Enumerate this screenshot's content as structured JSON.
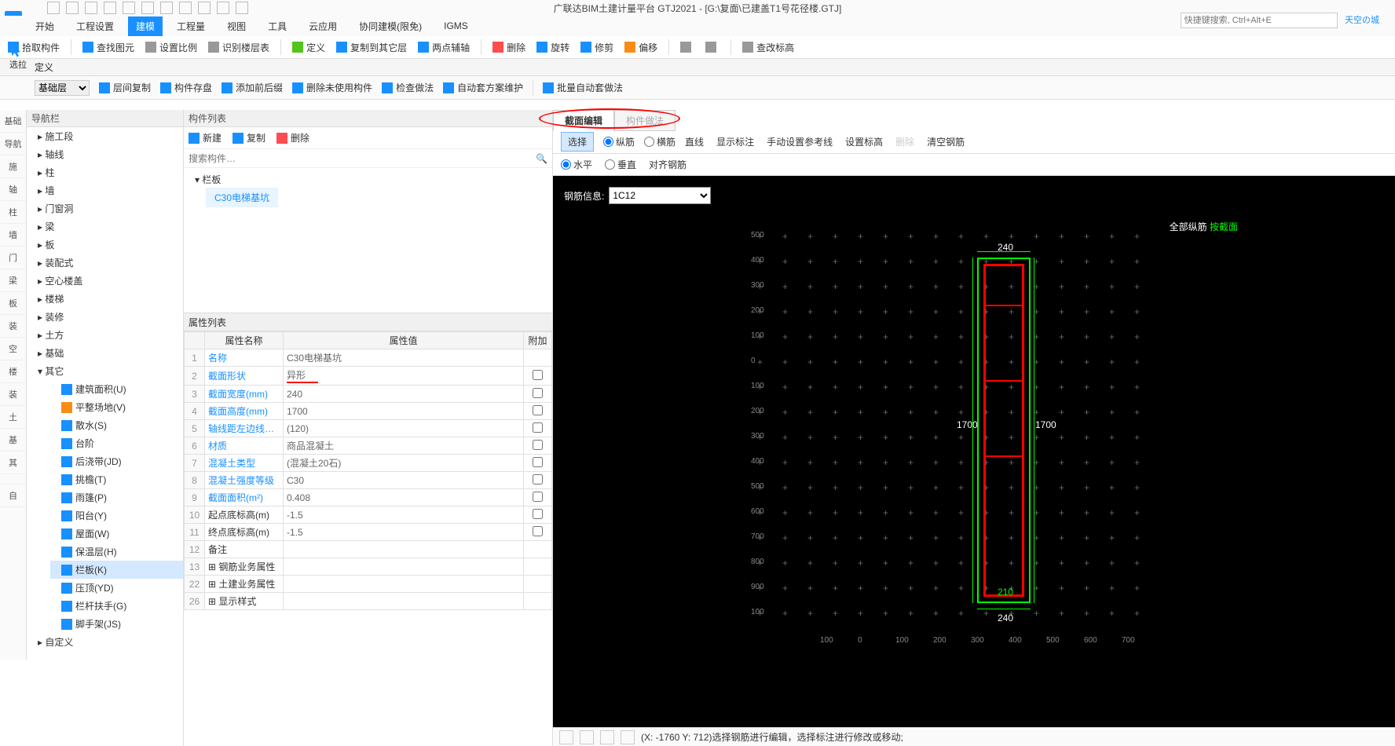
{
  "title": "广联达BIM土建计量平台 GTJ2021 - [G:\\复面\\已建盖T1号花径楼.GTJ]",
  "search_placeholder": "快捷键搜索, Ctrl+Alt+E",
  "user_label": "天空の城",
  "main_tabs": [
    "开始",
    "工程设置",
    "建模",
    "工程量",
    "视图",
    "工具",
    "云应用",
    "协同建模(限免)",
    "IGMS"
  ],
  "main_tab_active_idx": 2,
  "ribbon_row1": [
    {
      "label": "拾取构件",
      "ic": "blue"
    },
    {
      "label": "查找图元",
      "ic": "blue"
    },
    {
      "label": "设置比例",
      "ic": "gray"
    },
    {
      "label": "识别楼层表",
      "ic": "gray"
    },
    {
      "label": "定义",
      "ic": "green"
    },
    {
      "label": "复制到其它层",
      "ic": "blue"
    },
    {
      "label": "两点辅轴",
      "ic": "blue"
    },
    {
      "label": "删除",
      "ic": "red"
    },
    {
      "label": "旋转",
      "ic": "blue"
    },
    {
      "label": "修剪",
      "ic": "blue"
    },
    {
      "label": "偏移",
      "ic": "orange"
    },
    {
      "label": "",
      "ic": "gray"
    },
    {
      "label": "",
      "ic": "gray"
    },
    {
      "label": "查改标高",
      "ic": "gray"
    }
  ],
  "cursor_label": "选拉",
  "def_title": "定义",
  "sub_ribbon": {
    "combo_value": "基础层",
    "items": [
      "层间复制",
      "构件存盘",
      "添加前后缀",
      "删除未使用构件",
      "检查做法",
      "自动套方案维护",
      "批量自动套做法"
    ]
  },
  "left_strip": [
    "基础",
    "导航",
    "施",
    "轴",
    "柱",
    "墙",
    "门",
    "梁",
    "板",
    "装",
    "空",
    "楼",
    "装",
    "土",
    "基",
    "其",
    "",
    "自"
  ],
  "nav_header": "导航栏",
  "nav_tree": [
    {
      "label": "施工段",
      "exp": true
    },
    {
      "label": "轴线",
      "exp": true
    },
    {
      "label": "柱",
      "exp": true
    },
    {
      "label": "墙",
      "exp": true
    },
    {
      "label": "门窗洞",
      "exp": true
    },
    {
      "label": "梁",
      "exp": true
    },
    {
      "label": "板",
      "exp": true
    },
    {
      "label": "装配式",
      "exp": true
    },
    {
      "label": "空心楼盖",
      "exp": true
    },
    {
      "label": "楼梯",
      "exp": true
    },
    {
      "label": "装修",
      "exp": true
    },
    {
      "label": "土方",
      "exp": true
    },
    {
      "label": "基础",
      "exp": true
    },
    {
      "label": "其它",
      "exp": false,
      "children": [
        {
          "label": "建筑面积(U)",
          "ic": "blue"
        },
        {
          "label": "平整场地(V)",
          "ic": "orange"
        },
        {
          "label": "散水(S)",
          "ic": "blue"
        },
        {
          "label": "台阶",
          "ic": "blue"
        },
        {
          "label": "后浇带(JD)",
          "ic": "blue"
        },
        {
          "label": "挑檐(T)",
          "ic": "blue"
        },
        {
          "label": "雨篷(P)",
          "ic": "blue"
        },
        {
          "label": "阳台(Y)",
          "ic": "blue"
        },
        {
          "label": "屋面(W)",
          "ic": "blue"
        },
        {
          "label": "保温层(H)",
          "ic": "blue"
        },
        {
          "label": "栏板(K)",
          "ic": "blue",
          "sel": true
        },
        {
          "label": "压顶(YD)",
          "ic": "blue"
        },
        {
          "label": "栏杆扶手(G)",
          "ic": "blue"
        },
        {
          "label": "脚手架(JS)",
          "ic": "blue"
        }
      ]
    },
    {
      "label": "自定义",
      "exp": true
    }
  ],
  "comp_header": "构件列表",
  "comp_toolbar": [
    "新建",
    "复制",
    "删除"
  ],
  "comp_search_placeholder": "搜索构件…",
  "comp_tree_root": "栏板",
  "comp_tree_child": "C30电梯基坑",
  "prop_header": "属性列表",
  "prop_cols": [
    "属性名称",
    "属性值",
    "附加"
  ],
  "prop_rows": [
    {
      "n": "1",
      "name": "名称",
      "val": "C30电梯基坑",
      "blue": true
    },
    {
      "n": "2",
      "name": "截面形状",
      "val": "异形",
      "blue": true,
      "underline": true
    },
    {
      "n": "3",
      "name": "截面宽度(mm)",
      "val": "240",
      "blue": true
    },
    {
      "n": "4",
      "name": "截面高度(mm)",
      "val": "1700",
      "blue": true
    },
    {
      "n": "5",
      "name": "轴线距左边线…",
      "val": "(120)",
      "blue": true
    },
    {
      "n": "6",
      "name": "材质",
      "val": "商品混凝土",
      "blue": true
    },
    {
      "n": "7",
      "name": "混凝土类型",
      "val": "(混凝土20石)",
      "blue": true
    },
    {
      "n": "8",
      "name": "混凝土强度等级",
      "val": "C30",
      "blue": true
    },
    {
      "n": "9",
      "name": "截面面积(m²)",
      "val": "0.408",
      "blue": true
    },
    {
      "n": "10",
      "name": "起点底标高(m)",
      "val": "-1.5"
    },
    {
      "n": "11",
      "name": "终点底标高(m)",
      "val": "-1.5"
    },
    {
      "n": "12",
      "name": "备注",
      "val": ""
    },
    {
      "n": "13",
      "name": "钢筋业务属性",
      "val": "",
      "exp": true
    },
    {
      "n": "22",
      "name": "土建业务属性",
      "val": "",
      "exp": true
    },
    {
      "n": "26",
      "name": "显示样式",
      "val": "",
      "exp": true
    }
  ],
  "canvas_tabs": [
    "截面编辑",
    "构件做法"
  ],
  "canvas_tab_active": 0,
  "canvas_tb1": {
    "select": "选择",
    "vert": "纵筋",
    "horiz": "横筋",
    "items": [
      "直线",
      "显示标注",
      "手动设置参考线",
      "设置标高",
      "删除",
      "清空钢筋"
    ]
  },
  "canvas_tb2": {
    "h": "水平",
    "v": "垂直",
    "align": "对齐钢筋"
  },
  "info_label": "钢筋信息:",
  "info_value": "1C12",
  "legend": {
    "l1": "全部纵筋",
    "l2": "按截面"
  },
  "dims": {
    "top": "240",
    "left": "1700",
    "right": "1700",
    "bottom": "240",
    "bottom_inner": "210"
  },
  "status": "(X: -1760 Y: 712)选择钢筋进行编辑，选择标注进行修改或移动;",
  "y_ticks": [
    "500",
    "400",
    "300",
    "200",
    "100",
    "0",
    "100",
    "200",
    "300",
    "400",
    "500",
    "600",
    "700",
    "800",
    "900",
    "100"
  ],
  "x_ticks": [
    "100",
    "0",
    "100",
    "200",
    "300",
    "400",
    "500",
    "600",
    "700"
  ]
}
